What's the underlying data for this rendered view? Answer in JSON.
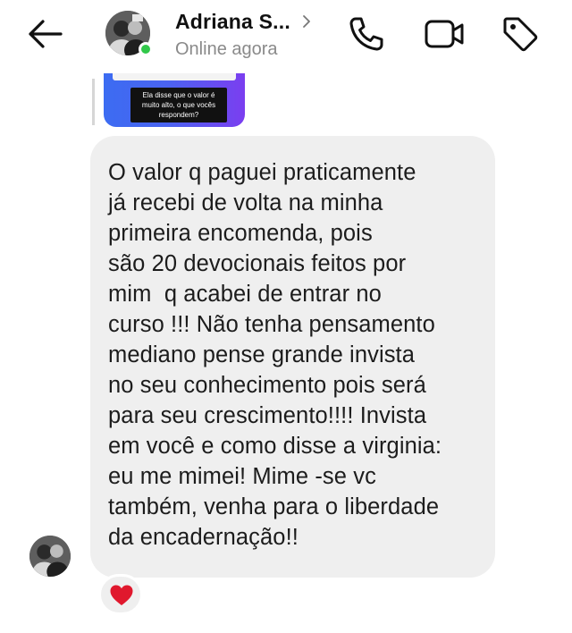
{
  "header": {
    "contact_name": "Adriana S...",
    "status": "Online agora",
    "icons": {
      "back": "arrow-left-icon",
      "chevron": "chevron-right-icon",
      "phone": "phone-icon",
      "video": "video-camera-icon",
      "tag": "tag-icon"
    },
    "online_color": "#31c84a"
  },
  "reply_preview": {
    "caption": "Ela disse que o valor é muito alto, o que vocês respondem?"
  },
  "message": {
    "text": "O valor q paguei praticamente\njá recebi de volta na minha\nprimeira encomenda, pois\nsão 20 devocionais feitos por\nmim  q acabei de entrar no\ncurso !!! Não tenha pensamento\nmediano pense grande invista\nno seu conhecimento pois será\npara seu crescimento!!!! Invista\nem você e como disse a virginia:\neu me mimei! Mime -se vc\ntambém, venha para o liberdade\nda encadernação!!",
    "bubble_color": "#efefef"
  },
  "reaction": {
    "icon": "heart-icon",
    "color": "#e0182d"
  }
}
